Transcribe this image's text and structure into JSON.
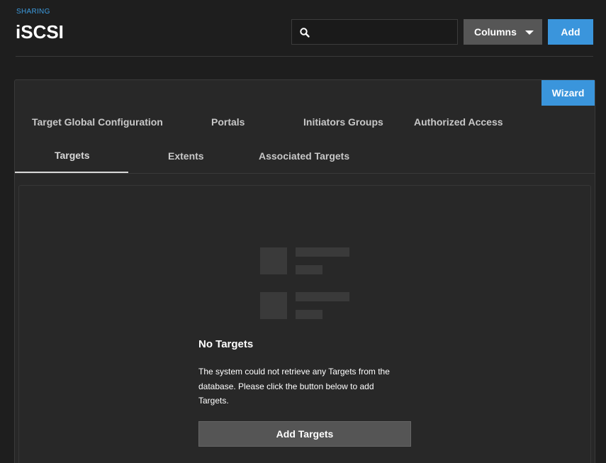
{
  "header": {
    "breadcrumb": "SHARING",
    "title": "iSCSI",
    "search_placeholder": "",
    "search_value": "",
    "columns_label": "Columns",
    "add_label": "Add"
  },
  "toolbar": {
    "wizard_label": "Wizard"
  },
  "tabs": [
    {
      "label": "Target Global Configuration",
      "active": false
    },
    {
      "label": "Portals",
      "active": false
    },
    {
      "label": "Initiators Groups",
      "active": false
    },
    {
      "label": "Authorized Access",
      "active": false
    },
    {
      "label": "Targets",
      "active": true
    },
    {
      "label": "Extents",
      "active": false
    },
    {
      "label": "Associated Targets",
      "active": false
    }
  ],
  "empty_state": {
    "icon": "empty-table-icon",
    "title": "No Targets",
    "message": "The system could not retrieve any Targets from the database. Please click the button below to add Targets.",
    "button_label": "Add Targets"
  },
  "colors": {
    "accent": "#3a95dc",
    "background": "#1e1e1e",
    "card": "#282828"
  }
}
